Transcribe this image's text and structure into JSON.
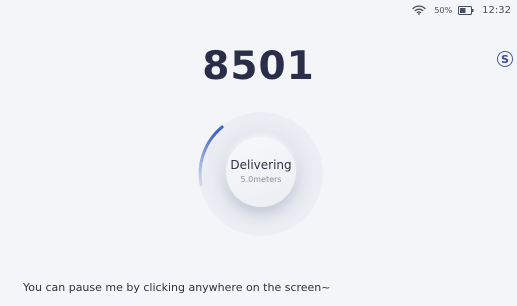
{
  "status_bar": {
    "battery_percent": "50%",
    "time": "12:32",
    "wifi_icon": "wifi-icon",
    "battery_icon": "battery-icon"
  },
  "task": {
    "number": "8501"
  },
  "help": {
    "icon": "help-icon",
    "glyph": "S"
  },
  "delivery": {
    "status": "Delivering",
    "distance": "5.0meters",
    "progress_fraction": 0.14,
    "accent_color": "#3f63c4"
  },
  "hint": {
    "text": "You can pause me by clicking anywhere on the screen~"
  }
}
